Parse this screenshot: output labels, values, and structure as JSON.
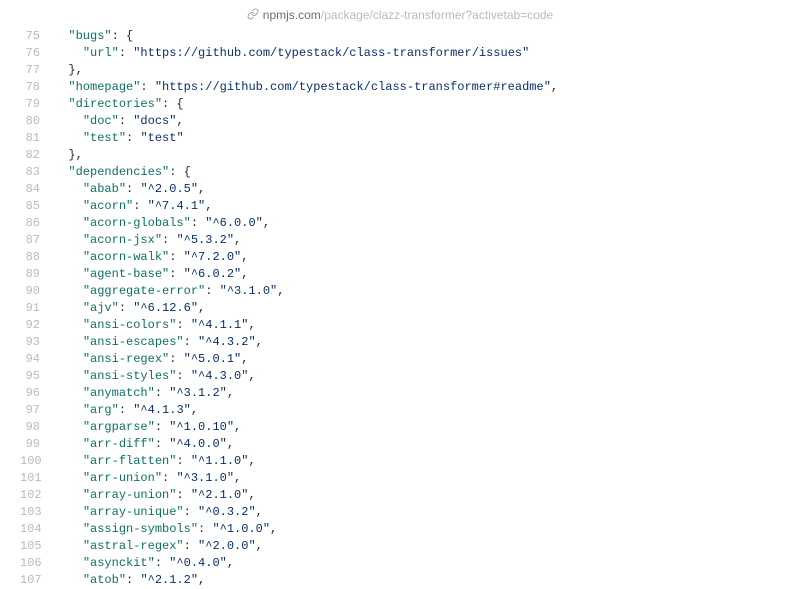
{
  "url": {
    "host": "npmjs.com",
    "path": "/package/clazz-transformer?activetab=code"
  },
  "lines": [
    {
      "n": 75,
      "indent": 1,
      "parts": [
        [
          "key",
          "\"bugs\""
        ],
        [
          "pun",
          ": {"
        ]
      ]
    },
    {
      "n": 76,
      "indent": 2,
      "parts": [
        [
          "key",
          "\"url\""
        ],
        [
          "pun",
          ": "
        ],
        [
          "str",
          "\"https://github.com/typestack/class-transformer/issues\""
        ]
      ]
    },
    {
      "n": 77,
      "indent": 1,
      "parts": [
        [
          "pun",
          "},"
        ]
      ]
    },
    {
      "n": 78,
      "indent": 1,
      "parts": [
        [
          "key",
          "\"homepage\""
        ],
        [
          "pun",
          ": "
        ],
        [
          "str",
          "\"https://github.com/typestack/class-transformer#readme\""
        ],
        [
          "pun",
          ","
        ]
      ]
    },
    {
      "n": 79,
      "indent": 1,
      "parts": [
        [
          "key",
          "\"directories\""
        ],
        [
          "pun",
          ": {"
        ]
      ]
    },
    {
      "n": 80,
      "indent": 2,
      "parts": [
        [
          "key",
          "\"doc\""
        ],
        [
          "pun",
          ": "
        ],
        [
          "str",
          "\"docs\""
        ],
        [
          "pun",
          ","
        ]
      ]
    },
    {
      "n": 81,
      "indent": 2,
      "parts": [
        [
          "key",
          "\"test\""
        ],
        [
          "pun",
          ": "
        ],
        [
          "str",
          "\"test\""
        ]
      ]
    },
    {
      "n": 82,
      "indent": 1,
      "parts": [
        [
          "pun",
          "},"
        ]
      ]
    },
    {
      "n": 83,
      "indent": 1,
      "parts": [
        [
          "key",
          "\"dependencies\""
        ],
        [
          "pun",
          ": {"
        ]
      ]
    },
    {
      "n": 84,
      "indent": 2,
      "parts": [
        [
          "key",
          "\"abab\""
        ],
        [
          "pun",
          ": "
        ],
        [
          "str",
          "\"^2.0.5\""
        ],
        [
          "pun",
          ","
        ]
      ]
    },
    {
      "n": 85,
      "indent": 2,
      "parts": [
        [
          "key",
          "\"acorn\""
        ],
        [
          "pun",
          ": "
        ],
        [
          "str",
          "\"^7.4.1\""
        ],
        [
          "pun",
          ","
        ]
      ]
    },
    {
      "n": 86,
      "indent": 2,
      "parts": [
        [
          "key",
          "\"acorn-globals\""
        ],
        [
          "pun",
          ": "
        ],
        [
          "str",
          "\"^6.0.0\""
        ],
        [
          "pun",
          ","
        ]
      ]
    },
    {
      "n": 87,
      "indent": 2,
      "parts": [
        [
          "key",
          "\"acorn-jsx\""
        ],
        [
          "pun",
          ": "
        ],
        [
          "str",
          "\"^5.3.2\""
        ],
        [
          "pun",
          ","
        ]
      ]
    },
    {
      "n": 88,
      "indent": 2,
      "parts": [
        [
          "key",
          "\"acorn-walk\""
        ],
        [
          "pun",
          ": "
        ],
        [
          "str",
          "\"^7.2.0\""
        ],
        [
          "pun",
          ","
        ]
      ]
    },
    {
      "n": 89,
      "indent": 2,
      "parts": [
        [
          "key",
          "\"agent-base\""
        ],
        [
          "pun",
          ": "
        ],
        [
          "str",
          "\"^6.0.2\""
        ],
        [
          "pun",
          ","
        ]
      ]
    },
    {
      "n": 90,
      "indent": 2,
      "parts": [
        [
          "key",
          "\"aggregate-error\""
        ],
        [
          "pun",
          ": "
        ],
        [
          "str",
          "\"^3.1.0\""
        ],
        [
          "pun",
          ","
        ]
      ]
    },
    {
      "n": 91,
      "indent": 2,
      "parts": [
        [
          "key",
          "\"ajv\""
        ],
        [
          "pun",
          ": "
        ],
        [
          "str",
          "\"^6.12.6\""
        ],
        [
          "pun",
          ","
        ]
      ]
    },
    {
      "n": 92,
      "indent": 2,
      "parts": [
        [
          "key",
          "\"ansi-colors\""
        ],
        [
          "pun",
          ": "
        ],
        [
          "str",
          "\"^4.1.1\""
        ],
        [
          "pun",
          ","
        ]
      ]
    },
    {
      "n": 93,
      "indent": 2,
      "parts": [
        [
          "key",
          "\"ansi-escapes\""
        ],
        [
          "pun",
          ": "
        ],
        [
          "str",
          "\"^4.3.2\""
        ],
        [
          "pun",
          ","
        ]
      ]
    },
    {
      "n": 94,
      "indent": 2,
      "parts": [
        [
          "key",
          "\"ansi-regex\""
        ],
        [
          "pun",
          ": "
        ],
        [
          "str",
          "\"^5.0.1\""
        ],
        [
          "pun",
          ","
        ]
      ]
    },
    {
      "n": 95,
      "indent": 2,
      "parts": [
        [
          "key",
          "\"ansi-styles\""
        ],
        [
          "pun",
          ": "
        ],
        [
          "str",
          "\"^4.3.0\""
        ],
        [
          "pun",
          ","
        ]
      ]
    },
    {
      "n": 96,
      "indent": 2,
      "parts": [
        [
          "key",
          "\"anymatch\""
        ],
        [
          "pun",
          ": "
        ],
        [
          "str",
          "\"^3.1.2\""
        ],
        [
          "pun",
          ","
        ]
      ]
    },
    {
      "n": 97,
      "indent": 2,
      "parts": [
        [
          "key",
          "\"arg\""
        ],
        [
          "pun",
          ": "
        ],
        [
          "str",
          "\"^4.1.3\""
        ],
        [
          "pun",
          ","
        ]
      ]
    },
    {
      "n": 98,
      "indent": 2,
      "parts": [
        [
          "key",
          "\"argparse\""
        ],
        [
          "pun",
          ": "
        ],
        [
          "str",
          "\"^1.0.10\""
        ],
        [
          "pun",
          ","
        ]
      ]
    },
    {
      "n": 99,
      "indent": 2,
      "parts": [
        [
          "key",
          "\"arr-diff\""
        ],
        [
          "pun",
          ": "
        ],
        [
          "str",
          "\"^4.0.0\""
        ],
        [
          "pun",
          ","
        ]
      ]
    },
    {
      "n": 100,
      "indent": 2,
      "parts": [
        [
          "key",
          "\"arr-flatten\""
        ],
        [
          "pun",
          ": "
        ],
        [
          "str",
          "\"^1.1.0\""
        ],
        [
          "pun",
          ","
        ]
      ]
    },
    {
      "n": 101,
      "indent": 2,
      "parts": [
        [
          "key",
          "\"arr-union\""
        ],
        [
          "pun",
          ": "
        ],
        [
          "str",
          "\"^3.1.0\""
        ],
        [
          "pun",
          ","
        ]
      ]
    },
    {
      "n": 102,
      "indent": 2,
      "parts": [
        [
          "key",
          "\"array-union\""
        ],
        [
          "pun",
          ": "
        ],
        [
          "str",
          "\"^2.1.0\""
        ],
        [
          "pun",
          ","
        ]
      ]
    },
    {
      "n": 103,
      "indent": 2,
      "parts": [
        [
          "key",
          "\"array-unique\""
        ],
        [
          "pun",
          ": "
        ],
        [
          "str",
          "\"^0.3.2\""
        ],
        [
          "pun",
          ","
        ]
      ]
    },
    {
      "n": 104,
      "indent": 2,
      "parts": [
        [
          "key",
          "\"assign-symbols\""
        ],
        [
          "pun",
          ": "
        ],
        [
          "str",
          "\"^1.0.0\""
        ],
        [
          "pun",
          ","
        ]
      ]
    },
    {
      "n": 105,
      "indent": 2,
      "parts": [
        [
          "key",
          "\"astral-regex\""
        ],
        [
          "pun",
          ": "
        ],
        [
          "str",
          "\"^2.0.0\""
        ],
        [
          "pun",
          ","
        ]
      ]
    },
    {
      "n": 106,
      "indent": 2,
      "parts": [
        [
          "key",
          "\"asynckit\""
        ],
        [
          "pun",
          ": "
        ],
        [
          "str",
          "\"^0.4.0\""
        ],
        [
          "pun",
          ","
        ]
      ]
    },
    {
      "n": 107,
      "indent": 2,
      "parts": [
        [
          "key",
          "\"atob\""
        ],
        [
          "pun",
          ": "
        ],
        [
          "str",
          "\"^2.1.2\""
        ],
        [
          "pun",
          ","
        ]
      ]
    }
  ]
}
